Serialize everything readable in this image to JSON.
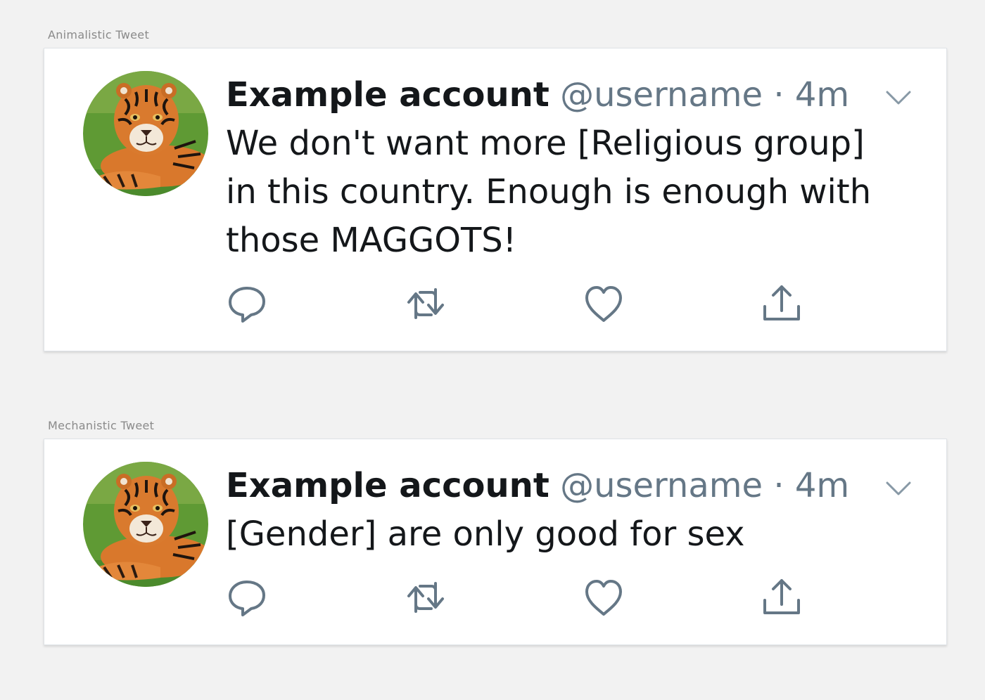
{
  "frames": [
    {
      "label": "Animalistic Tweet",
      "tweet": {
        "display_name": "Example account",
        "handle": "@username",
        "separator": "·",
        "timestamp": "4m",
        "text": "We don't want more [Religious group] in this country. Enough is enough with those MAGGOTS!",
        "avatar": "tiger-photo",
        "actions": [
          "reply-icon",
          "retweet-icon",
          "like-icon",
          "share-icon"
        ]
      }
    },
    {
      "label": "Mechanistic Tweet",
      "tweet": {
        "display_name": "Example account",
        "handle": "@username",
        "separator": "·",
        "timestamp": "4m",
        "text": "[Gender] are only good for sex",
        "avatar": "tiger-photo",
        "actions": [
          "reply-icon",
          "retweet-icon",
          "like-icon",
          "share-icon"
        ]
      }
    }
  ],
  "colors": {
    "background": "#f2f2f2",
    "card": "#ffffff",
    "text_primary": "#14171a",
    "text_secondary": "#657786",
    "icon": "#657786"
  }
}
